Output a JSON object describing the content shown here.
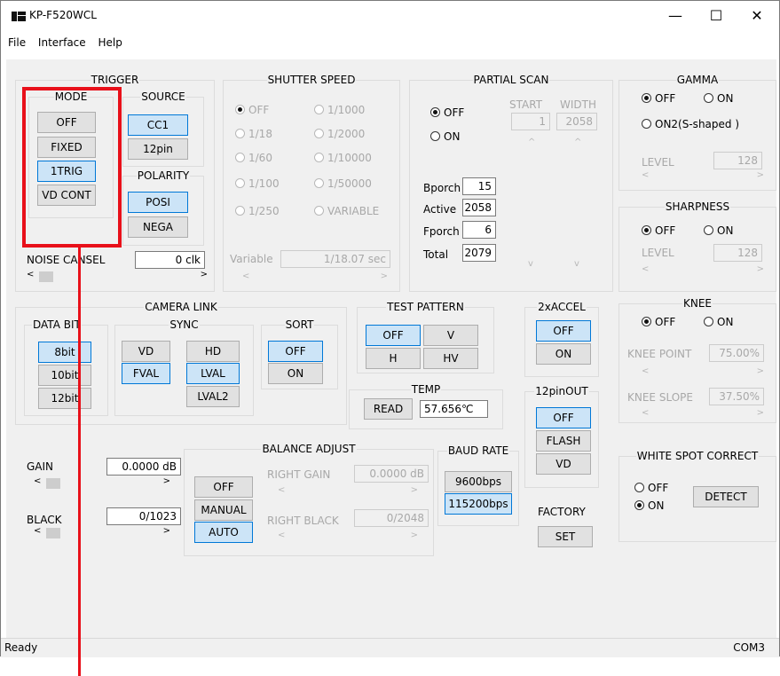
{
  "window": {
    "title": "KP-F520WCL",
    "minimize": "—",
    "maximize": "☐",
    "close": "✕"
  },
  "menu": [
    "File",
    "Interface",
    "Help"
  ],
  "trigger": {
    "title": "TRIGGER",
    "mode": {
      "title": "MODE",
      "buttons": [
        "OFF",
        "FIXED",
        "1TRIG",
        "VD CONT"
      ],
      "selected": "1TRIG"
    },
    "source": {
      "title": "SOURCE",
      "buttons": [
        "CC1",
        "12pin"
      ],
      "selected": "CC1"
    },
    "polarity": {
      "title": "POLARITY",
      "buttons": [
        "POSI",
        "NEGA"
      ],
      "selected": "POSI"
    },
    "noise_cancel": {
      "label": "NOISE CANSEL",
      "value": "0 clk"
    }
  },
  "shutter": {
    "title": "SHUTTER SPEED",
    "options": [
      "OFF",
      "1/18",
      "1/60",
      "1/100",
      "1/250",
      "1/1000",
      "1/2000",
      "1/10000",
      "1/50000",
      "VARIABLE"
    ],
    "variable_label": "Variable",
    "variable_value": "1/18.07 sec"
  },
  "partial": {
    "title": "PARTIAL SCAN",
    "off": "OFF",
    "on": "ON",
    "start_label": "START",
    "width_label": "WIDTH",
    "start_value": "1",
    "width_value": "2058",
    "rows": [
      {
        "label": "Bporch",
        "value": "15"
      },
      {
        "label": "Active",
        "value": "2058"
      },
      {
        "label": "Fporch",
        "value": "6"
      },
      {
        "label": "Total",
        "value": "2079"
      }
    ]
  },
  "gamma": {
    "title": "GAMMA",
    "off": "OFF",
    "on": "ON",
    "on2": "ON2(S-shaped )",
    "level_label": "LEVEL",
    "level_value": "128"
  },
  "sharpness": {
    "title": "SHARPNESS",
    "off": "OFF",
    "on": "ON",
    "level_label": "LEVEL",
    "level_value": "128"
  },
  "knee": {
    "title": "KNEE",
    "off": "OFF",
    "on": "ON",
    "point_label": "KNEE POINT",
    "point_value": "75.00%",
    "slope_label": "KNEE SLOPE",
    "slope_value": "37.50%"
  },
  "camera_link": {
    "title": "CAMERA LINK",
    "data_bit": {
      "title": "DATA BIT",
      "buttons": [
        "8bit",
        "10bit",
        "12bit"
      ],
      "selected": "8bit"
    },
    "sync": {
      "title": "SYNC",
      "buttons": [
        "VD",
        "HD",
        "FVAL",
        "LVAL",
        "LVAL2"
      ],
      "selected": [
        "FVAL",
        "LVAL"
      ]
    },
    "sort": {
      "title": "SORT",
      "buttons": [
        "OFF",
        "ON"
      ],
      "selected": "OFF"
    }
  },
  "test_pattern": {
    "title": "TEST PATTERN",
    "buttons": [
      "OFF",
      "V",
      "H",
      "HV"
    ],
    "selected": "OFF"
  },
  "temp": {
    "title": "TEMP",
    "button": "READ",
    "value": "57.656℃"
  },
  "accel": {
    "title": "2xACCEL",
    "buttons": [
      "OFF",
      "ON"
    ],
    "selected": "OFF"
  },
  "pinout": {
    "title": "12pinOUT",
    "buttons": [
      "OFF",
      "FLASH",
      "VD"
    ],
    "selected": "OFF"
  },
  "gain": {
    "label": "GAIN",
    "value": "0.0000 dB"
  },
  "black": {
    "label": "BLACK",
    "value": "0/1023"
  },
  "balance": {
    "title": "BALANCE ADJUST",
    "buttons": [
      "OFF",
      "MANUAL",
      "AUTO"
    ],
    "selected": "AUTO",
    "right_gain_label": "RIGHT GAIN",
    "right_gain_value": "0.0000 dB",
    "right_black_label": "RIGHT BLACK",
    "right_black_value": "0/2048"
  },
  "baud": {
    "title": "BAUD RATE",
    "buttons": [
      "9600bps",
      "115200bps"
    ],
    "selected": "115200bps"
  },
  "factory": {
    "title": "FACTORY",
    "button": "SET"
  },
  "white_spot": {
    "title": "WHITE SPOT CORRECT",
    "off": "OFF",
    "on": "ON",
    "button": "DETECT"
  },
  "status": {
    "left": "Ready",
    "right": "COM3"
  },
  "arrows": {
    "left": "<",
    "right": ">",
    "up": "^",
    "down": "v"
  },
  "colors": {
    "selected_bg": "#cce4f7",
    "selected_border": "#0078d7",
    "highlight": "#e8101a",
    "panel": "#f0f0f0"
  }
}
